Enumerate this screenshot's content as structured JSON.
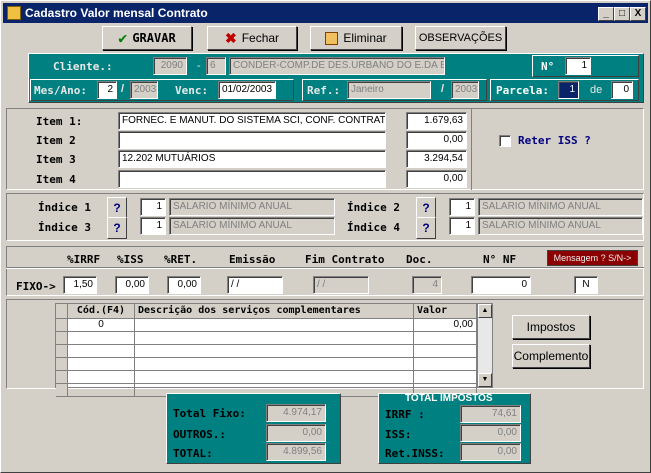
{
  "window": {
    "title": "Cadastro Valor mensal Contrato",
    "controls": [
      "_",
      "□",
      "X"
    ]
  },
  "toolbar": {
    "gravar": "GRAVAR",
    "fechar": "Fechar",
    "eliminar": "Eliminar",
    "observacoes": "OBSERVAÇÕES"
  },
  "header": {
    "cliente_label": "Cliente.:",
    "cliente_code": "2090",
    "cliente_dash": "-",
    "cliente_sub": "6",
    "cliente_name": "CONDER-COMP.DE DES.URBANO DO E.DA BA",
    "numero_label": "N°",
    "numero": "1",
    "mesano_label": "Mes/Ano:",
    "mes": "2",
    "slash1": "/",
    "ano": "2003",
    "venc_label": "Venc:",
    "venc": "01/02/2003",
    "ref_label": "Ref.:",
    "ref_mes": "Janeiro",
    "slash2": "/",
    "ref_ano": "2003",
    "parcela_label": "Parcela:",
    "parcela": "1",
    "de_label": "de",
    "parcela_total": "0"
  },
  "items": [
    {
      "label": "Item 1:",
      "desc": "FORNEC. E MANUT. DO SISTEMA SCI, CONF. CONTRATO",
      "valor": "1.679,63"
    },
    {
      "label": "Item 2",
      "desc": "",
      "valor": "0,00"
    },
    {
      "label": "Item 3",
      "desc": "12.202 MUTUÁRIOS",
      "valor": "3.294,54"
    },
    {
      "label": "Item 4",
      "desc": "",
      "valor": "0,00"
    }
  ],
  "reter_iss": "Reter ISS ?",
  "indices": [
    {
      "label": "Índice 1",
      "num": "1",
      "desc": "SALARIO MÍNIMO ANUAL"
    },
    {
      "label": "Índice 2",
      "num": "1",
      "desc": "SALARIO MÍNIMO ANUAL"
    },
    {
      "label": "Índice 3",
      "num": "1",
      "desc": "SALARIO MÍNIMO ANUAL"
    },
    {
      "label": "Índice 4",
      "num": "1",
      "desc": "SALARIO MÍNIMO ANUAL"
    }
  ],
  "impostos_row": {
    "h_irrf": "%IRRF",
    "h_iss": "%ISS",
    "h_ret": "%RET.",
    "h_emissao": "Emissão",
    "h_fim": "Fim Contrato",
    "h_doc": "Doc.",
    "h_nf": "N° NF",
    "mensagem": "Mensagem ? S/N->",
    "fixo_label": "FIXO->",
    "irrf": "1,50",
    "iss": "0,00",
    "ret": "0,00",
    "emissao": "/ /",
    "fim": "/ /",
    "doc": "4",
    "nf": "0",
    "msg": "N"
  },
  "grid": {
    "headers": [
      "Cód.(F4)",
      "Descrição dos serviços complementares",
      "Valor"
    ],
    "rows": [
      [
        "0",
        "",
        "0,00"
      ],
      [
        "",
        "",
        ""
      ],
      [
        "",
        "",
        ""
      ],
      [
        "",
        "",
        ""
      ],
      [
        "",
        "",
        ""
      ],
      [
        "",
        "",
        ""
      ]
    ]
  },
  "side_buttons": {
    "impostos": "Impostos",
    "complemento": "Complemento"
  },
  "totals": {
    "total_fixo_label": "Total Fixo:",
    "total_fixo": "4.974,17",
    "outros_label": "OUTROS.:",
    "outros": "0,00",
    "total_label": "TOTAL:",
    "total": "4.899,56"
  },
  "total_impostos": {
    "title": "TOTAL IMPOSTOS",
    "irrf_label": "IRRF :",
    "irrf": "74,61",
    "iss_label": "ISS:",
    "iss": "0,00",
    "ret_label": "Ret.INSS:",
    "ret": "0,00"
  },
  "colors": {
    "teal": "#008080",
    "title_bar": "#0a246a",
    "face": "#d4d0c8",
    "mensagem_bg": "#8b0000",
    "reter_text": "#000080"
  }
}
